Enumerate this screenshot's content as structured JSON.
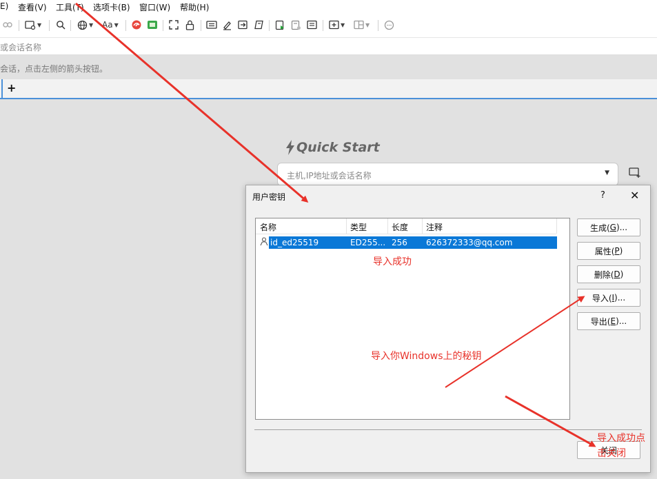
{
  "menu": [
    "E)",
    "查看(V)",
    "工具(T)",
    "选项卡(B)",
    "窗口(W)",
    "帮助(H)"
  ],
  "toolbar": {
    "icons": [
      "link-icon",
      "new-session-icon",
      "search-icon",
      "globe-icon",
      "font-icon",
      "swirl-app-icon",
      "green-app-icon",
      "fullscreen-icon",
      "lock-icon",
      "keyboard-icon",
      "compose-icon",
      "transfer-icon",
      "script-icon",
      "run-script-icon",
      "log-icon",
      "notes-icon",
      "new-tab-icon",
      "layout-icon",
      "chat-icon"
    ],
    "font_label": "Aa"
  },
  "address_placeholder": "或会话名称",
  "hint_text": "会话，点击左侧的箭头按钮。",
  "tabstrip": {
    "add_label": "+"
  },
  "quick_start": {
    "title": "Quick Start",
    "input_placeholder": "主机,IP地址或会话名称"
  },
  "dialog": {
    "title": "用户密钥",
    "help": "?",
    "close": "✕",
    "columns": [
      "名称",
      "类型",
      "长度",
      "注释"
    ],
    "rows": [
      {
        "name": "id_ed25519",
        "type": "ED255...",
        "length": "256",
        "comment": "626372333@qq.com"
      }
    ],
    "buttons": [
      {
        "text": "生成(",
        "key": "G",
        "tail": ")..."
      },
      {
        "text": "属性(",
        "key": "P",
        "tail": ")"
      },
      {
        "text": "删除(",
        "key": "D",
        "tail": ")"
      },
      {
        "text": "导入(",
        "key": "I",
        "tail": ")..."
      },
      {
        "text": "导出(",
        "key": "E",
        "tail": ")..."
      }
    ],
    "close_button": "关闭"
  },
  "annotations": {
    "success": "导入成功",
    "import_hint": "导入你Windows上的秘钥",
    "close_hint_line1": "导入成功点",
    "close_hint_line2": "击关闭",
    "color": "#e8322a"
  }
}
